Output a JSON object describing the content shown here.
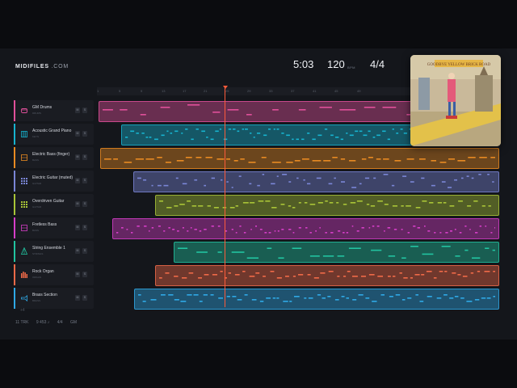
{
  "brand": {
    "name": "MIDIFILES",
    "suffix": ".COM"
  },
  "stats": {
    "duration": "5:03",
    "tempo": "120",
    "tempo_unit": "BPM",
    "time_signature": "4/4"
  },
  "album_art": {
    "title": "GOODBYE YELLOW BRICK ROAD"
  },
  "ruler_ticks": [
    "1",
    "5",
    "9",
    "13",
    "17",
    "21",
    "25",
    "29",
    "33",
    "37",
    "41",
    "45",
    "49"
  ],
  "add_track_label": "+4",
  "tracks": [
    {
      "name": "GM Drums",
      "sub": "DRUMS",
      "color": "#e0509a",
      "icon": "drum-icon",
      "mute": "M",
      "solo": "S"
    },
    {
      "name": "Acoustic Grand Piano",
      "sub": "KEYS",
      "color": "#17b3cf",
      "icon": "piano-icon",
      "mute": "M",
      "solo": "S"
    },
    {
      "name": "Electric Bass (finger)",
      "sub": "BASS",
      "color": "#e88a22",
      "icon": "bass-icon",
      "mute": "M",
      "solo": "S"
    },
    {
      "name": "Electric Guitar (muted)",
      "sub": "GUITAR",
      "color": "#7a86d6",
      "icon": "guitar-grid-icon",
      "mute": "M",
      "solo": "S"
    },
    {
      "name": "Overdriven Guitar",
      "sub": "GUITAR",
      "color": "#a9c437",
      "icon": "guitar-grid-icon",
      "mute": "M",
      "solo": "S"
    },
    {
      "name": "Fretless Bass",
      "sub": "BASS",
      "color": "#d63ec8",
      "icon": "bass-icon",
      "mute": "M",
      "solo": "S"
    },
    {
      "name": "String Ensemble 1",
      "sub": "STRINGS",
      "color": "#22c3a0",
      "icon": "strings-icon",
      "mute": "M",
      "solo": "S"
    },
    {
      "name": "Rock Organ",
      "sub": "ORGAN",
      "color": "#f06a48",
      "icon": "organ-icon",
      "mute": "M",
      "solo": "S"
    },
    {
      "name": "Brass Section",
      "sub": "BRASS",
      "color": "#2fa9e6",
      "icon": "brass-icon",
      "mute": "M",
      "solo": "S"
    }
  ],
  "status": {
    "tracks": "11 TRK",
    "notes": "9 453 ♪",
    "sig": "4/4",
    "mode": "GM"
  }
}
